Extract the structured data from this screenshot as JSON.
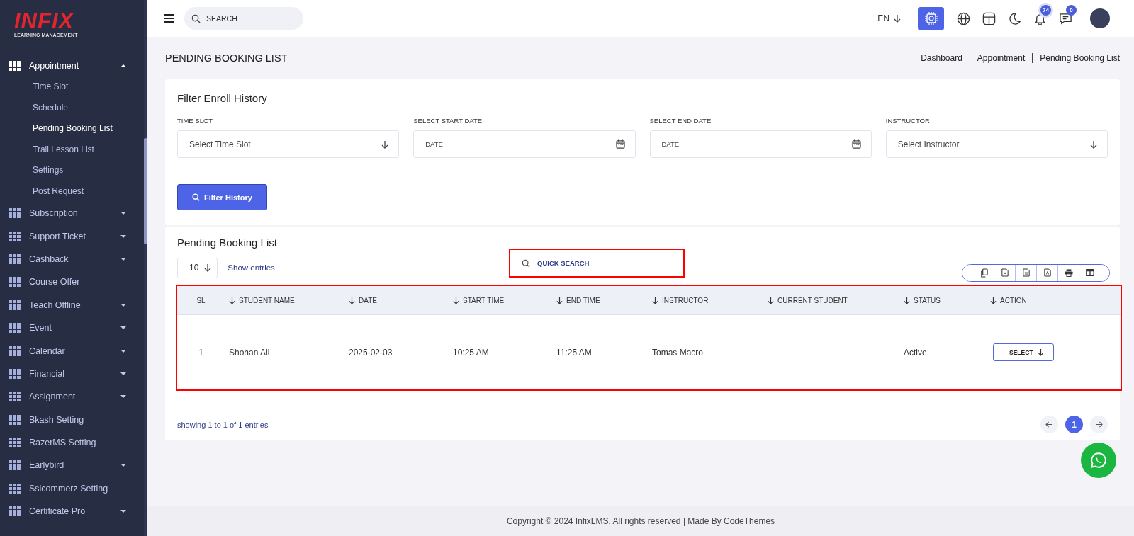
{
  "sidebar": {
    "logo": {
      "title": "INFIX",
      "subtitle": "LEARNING MANAGEMENT"
    },
    "menu": [
      {
        "label": "Appointment",
        "kind": "group",
        "expanded": true,
        "children": [
          {
            "label": "Time Slot",
            "selected": false
          },
          {
            "label": "Schedule",
            "selected": false
          },
          {
            "label": "Pending Booking List",
            "selected": true
          },
          {
            "label": "Trail Lesson List",
            "selected": false
          },
          {
            "label": "Settings",
            "selected": false
          },
          {
            "label": "Post Request",
            "selected": false
          }
        ]
      },
      {
        "label": "Subscription",
        "kind": "group",
        "expanded": false
      },
      {
        "label": "Support Ticket",
        "kind": "group",
        "expanded": false
      },
      {
        "label": "Cashback",
        "kind": "group",
        "expanded": false
      },
      {
        "label": "Course Offer",
        "kind": "link"
      },
      {
        "label": "Teach Offline",
        "kind": "group",
        "expanded": false
      },
      {
        "label": "Event",
        "kind": "group",
        "expanded": false
      },
      {
        "label": "Calendar",
        "kind": "group",
        "expanded": false
      },
      {
        "label": "Financial",
        "kind": "group",
        "expanded": false
      },
      {
        "label": "Assignment",
        "kind": "group",
        "expanded": false
      },
      {
        "label": "Bkash Setting",
        "kind": "link"
      },
      {
        "label": "RazerMS Setting",
        "kind": "link"
      },
      {
        "label": "Earlybird",
        "kind": "group",
        "expanded": false
      },
      {
        "label": "Sslcommerz Setting",
        "kind": "link"
      },
      {
        "label": "Certificate Pro",
        "kind": "group",
        "expanded": false
      }
    ]
  },
  "topbar": {
    "search": {
      "placeholder": "SEARCH"
    },
    "language": "EN",
    "notifications": "74",
    "messages": "0"
  },
  "page": {
    "title": "PENDING BOOKING LIST",
    "breadcrumb": [
      "Dashboard",
      "Appointment",
      "Pending Booking List"
    ]
  },
  "filter": {
    "title": "Filter Enroll History",
    "fields": [
      {
        "label": "TIME SLOT",
        "kind": "select",
        "placeholder": "Select Time Slot"
      },
      {
        "label": "SELECT START DATE",
        "kind": "date",
        "placeholder": "DATE"
      },
      {
        "label": "SELECT END DATE",
        "kind": "date",
        "placeholder": "DATE"
      },
      {
        "label": "INSTRUCTOR",
        "kind": "select",
        "placeholder": "Select Instructor"
      }
    ],
    "button": "Filter History"
  },
  "table": {
    "title": "Pending Booking List",
    "page_size": "10",
    "show_entries": "Show entries",
    "quick_search": {
      "placeholder": "QUICK SEARCH"
    },
    "columns": [
      {
        "label": "SL",
        "sortable": false
      },
      {
        "label": "STUDENT NAME",
        "sortable": true
      },
      {
        "label": "DATE",
        "sortable": true
      },
      {
        "label": "START TIME",
        "sortable": true
      },
      {
        "label": "END TIME",
        "sortable": true
      },
      {
        "label": "INSTRUCTOR",
        "sortable": true
      },
      {
        "label": "CURRENT STUDENT",
        "sortable": true
      },
      {
        "label": "STATUS",
        "sortable": true
      },
      {
        "label": "ACTION",
        "sortable": true
      }
    ],
    "rows": [
      {
        "cells": [
          "1",
          "Shohan Ali",
          "2025-02-03",
          "10:25 AM",
          "11:25 AM",
          "Tomas Macro",
          "",
          "Active"
        ],
        "action": "SELECT"
      }
    ],
    "summary": "showing 1 to 1 of 1 entries",
    "pages": [
      {
        "label": "1",
        "selected": true
      }
    ]
  },
  "footer": "Copyright © 2024 InfixLMS. All rights reserved | Made By CodeThemes"
}
